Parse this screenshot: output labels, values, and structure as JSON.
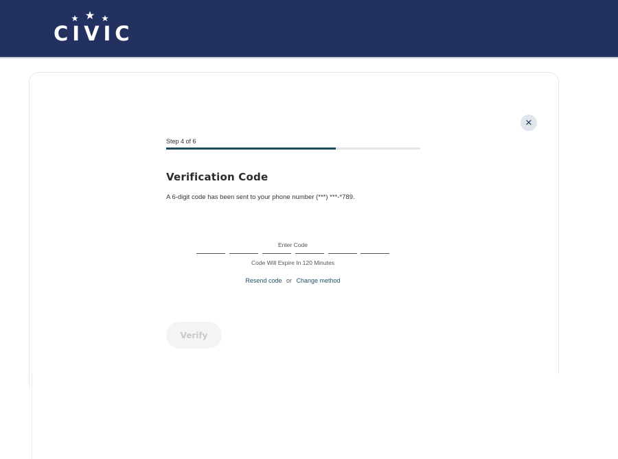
{
  "header": {
    "logo_text": "CIVIC",
    "logo_reg": "®",
    "background_color": "#22315f"
  },
  "dialog": {
    "close_icon": "×",
    "step_label": "Step 4 of 6",
    "progress": {
      "current_step": 4,
      "total_steps": 6
    },
    "title": "Verification Code",
    "subtitle": "A 6-digit code has been sent to your phone number (***) ***-*789.",
    "code": {
      "label": "Enter Code",
      "digits": [
        "",
        "",
        "",
        "",
        "",
        ""
      ],
      "expire_text": "Code Will Expire In 120 Minutes"
    },
    "links": {
      "resend": "Resend code",
      "separator": "or",
      "change_method": "Change method"
    },
    "verify_button": "Verify"
  },
  "colors": {
    "accent": "#1b4a5e",
    "link": "#1f4f66",
    "disabled_bg": "#f4f4f4",
    "disabled_text": "#c9c9c9"
  }
}
